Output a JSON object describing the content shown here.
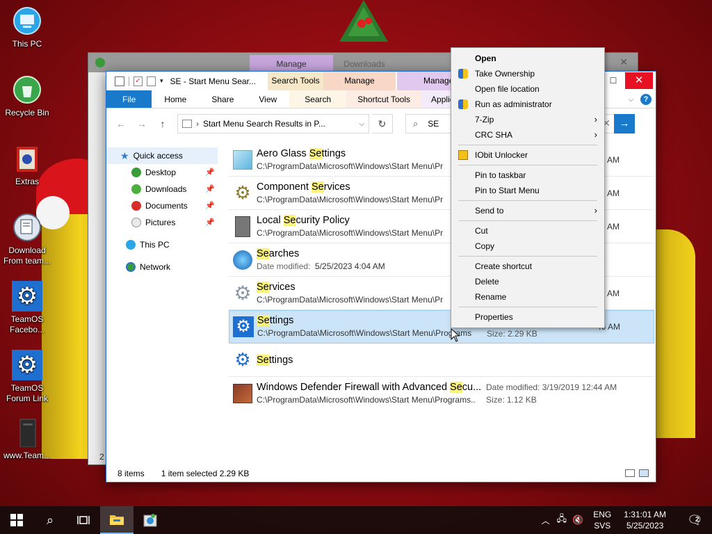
{
  "desktop": {
    "icons": [
      {
        "label": "This PC"
      },
      {
        "label": "Recycle Bin"
      },
      {
        "label": "Extras"
      },
      {
        "label": "Download From team..."
      },
      {
        "label": "TeamOS Facebo..."
      },
      {
        "label": "TeamOS Forum Link"
      },
      {
        "label": "www.Team..."
      }
    ]
  },
  "back_window": {
    "tabs": [
      "Manage",
      "Downloads"
    ],
    "side_digit": "2"
  },
  "window": {
    "title": "SE - Start Menu Sear...",
    "context_groups": [
      "Search Tools",
      "Manage",
      "Manage"
    ],
    "ribbon_tabs": [
      "File",
      "Home",
      "Share",
      "View",
      "Search",
      "Shortcut Tools",
      "Application"
    ],
    "address": "Start Menu Search Results in P...",
    "search_value": "SE",
    "nav": [
      {
        "label": "Quick access"
      },
      {
        "label": "Desktop"
      },
      {
        "label": "Downloads"
      },
      {
        "label": "Documents"
      },
      {
        "label": "Pictures"
      },
      {
        "label": "This PC"
      },
      {
        "label": "Network"
      }
    ],
    "results": [
      {
        "pre": "Aero Glass ",
        "hl": "Se",
        "post": "ttings",
        "sub": "C:\\ProgramData\\Microsoft\\Windows\\Start Menu\\Pr",
        "right": "",
        "time": "56 AM"
      },
      {
        "pre": "Component ",
        "hl": "Se",
        "post": "rvices",
        "sub": "C:\\ProgramData\\Microsoft\\Windows\\Start Menu\\Pr",
        "right": "",
        "time": "45 AM"
      },
      {
        "pre": "Local ",
        "hl": "Se",
        "post": "curity Policy",
        "sub": "C:\\ProgramData\\Microsoft\\Windows\\Start Menu\\Pr",
        "right": "",
        "time": "46 AM"
      },
      {
        "pre": "",
        "hl": "Se",
        "post": "arches",
        "sub_label": "Date modified:",
        "sub": "5/25/2023 4:04 AM",
        "right": "",
        "time": ""
      },
      {
        "pre": "",
        "hl": "Se",
        "post": "rvices",
        "sub": "C:\\ProgramData\\Microsoft\\Windows\\Start Menu\\Pr",
        "right": "",
        "time": "45 AM"
      },
      {
        "pre": "",
        "hl": "Se",
        "post": "ttings",
        "sub": "C:\\ProgramData\\Microsoft\\Windows\\Start Menu\\Programs",
        "right": "Size:  2.29 KB",
        "time": "46 AM"
      },
      {
        "pre": "",
        "hl": "Se",
        "post": "ttings",
        "sub": "",
        "right": "",
        "time": ""
      },
      {
        "pre": "Windows Defender Firewall with Advanced ",
        "hl": "Se",
        "post": "cu...",
        "sub": "C:\\ProgramData\\Microsoft\\Windows\\Start Menu\\Programs...",
        "right": "Date modified:  3/19/2019 12:44 AM",
        "right2": "Size:  1.12 KB",
        "time": ""
      }
    ],
    "status": {
      "count": "8 items",
      "selected": "1 item selected  2.29 KB"
    }
  },
  "context_menu": {
    "items": [
      "Open",
      "Take Ownership",
      "Open file location",
      "Run as administrator",
      "7-Zip",
      "CRC SHA",
      "IObit Unlocker",
      "Pin to taskbar",
      "Pin to Start Menu",
      "Send to",
      "Cut",
      "Copy",
      "Create shortcut",
      "Delete",
      "Rename",
      "Properties"
    ]
  },
  "taskbar": {
    "lang": "ENG",
    "layout": "SVS",
    "time": "1:31:01 AM",
    "date": "5/25/2023",
    "notifications": "2"
  },
  "colors": {
    "accent": "#1979ca",
    "selection": "#cce4f7",
    "highlight": "#fbf27a",
    "close": "#e81123"
  }
}
